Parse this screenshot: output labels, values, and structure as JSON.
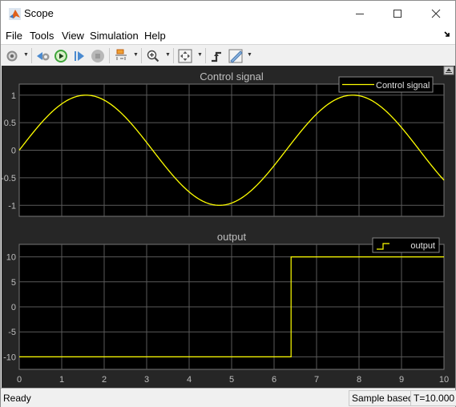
{
  "window": {
    "title": "Scope",
    "icons": {
      "app": "matlab-icon",
      "minimize": "minimize-icon",
      "maximize": "maximize-icon",
      "close": "close-icon"
    }
  },
  "menu": {
    "items": [
      "File",
      "Tools",
      "View",
      "Simulation",
      "Help"
    ]
  },
  "toolbar": {
    "buttons": [
      {
        "name": "configuration-properties",
        "icon": "gear-icon",
        "dropdown": true
      },
      {
        "name": "step-back",
        "icon": "step-back-icon",
        "dropdown": false
      },
      {
        "name": "run",
        "icon": "play-icon",
        "dropdown": false
      },
      {
        "name": "step-forward",
        "icon": "step-forward-icon",
        "dropdown": false
      },
      {
        "name": "stop",
        "icon": "stop-icon",
        "dropdown": false
      },
      {
        "name": "highlight-simulink-block",
        "icon": "highlight-block-icon",
        "dropdown": true
      },
      {
        "name": "zoom-in",
        "icon": "zoom-in-icon",
        "dropdown": true
      },
      {
        "name": "scale-axes",
        "icon": "autoscale-icon",
        "dropdown": true
      },
      {
        "name": "triggers",
        "icon": "trigger-icon",
        "dropdown": false
      },
      {
        "name": "cursor-measurements",
        "icon": "ruler-icon",
        "dropdown": true
      }
    ]
  },
  "status": {
    "state": "Ready",
    "mode": "Sample based",
    "time": "T=10.000"
  },
  "colors": {
    "trace": "#ffff00",
    "plot_bg": "#000000",
    "figure_bg": "#262626",
    "grid": "#5a5a5a",
    "tick_text": "#bfbfbf"
  },
  "chart_data": [
    {
      "type": "line",
      "title": "Control signal",
      "xlabel": "",
      "ylabel": "",
      "xlim": [
        0,
        10
      ],
      "ylim": [
        -1.2,
        1.2
      ],
      "xticks": [
        0,
        1,
        2,
        3,
        4,
        5,
        6,
        7,
        8,
        9,
        10
      ],
      "yticks": [
        -1,
        -0.5,
        0,
        0.5,
        1
      ],
      "ytick_labels": [
        "-1",
        "-0.5",
        "0",
        "0.5",
        "1"
      ],
      "show_xtick_labels": false,
      "grid": true,
      "legend": {
        "entries": [
          "Control signal"
        ],
        "placement": "top-right"
      },
      "series": [
        {
          "name": "Control signal",
          "function": "sin(t)",
          "x": [
            0,
            0.5,
            1,
            1.5708,
            2,
            2.5,
            3,
            3.5,
            4,
            4.7124,
            5,
            5.5,
            6,
            6.5,
            7,
            7.854,
            8,
            8.5,
            9,
            9.5,
            10
          ],
          "values": [
            0,
            0.479,
            0.841,
            1.0,
            0.909,
            0.598,
            0.141,
            -0.351,
            -0.757,
            -1.0,
            -0.959,
            -0.706,
            -0.279,
            0.215,
            0.657,
            1.0,
            0.989,
            0.798,
            0.412,
            -0.075,
            -0.544
          ]
        }
      ]
    },
    {
      "type": "line",
      "title": "output",
      "xlabel": "",
      "ylabel": "",
      "xlim": [
        0,
        10
      ],
      "ylim": [
        -12.5,
        12.5
      ],
      "xticks": [
        0,
        1,
        2,
        3,
        4,
        5,
        6,
        7,
        8,
        9,
        10
      ],
      "xtick_labels": [
        "0",
        "1",
        "2",
        "3",
        "4",
        "5",
        "6",
        "7",
        "8",
        "9",
        "10"
      ],
      "yticks": [
        -10,
        -5,
        0,
        5,
        10
      ],
      "ytick_labels": [
        "-10",
        "-5",
        "0",
        "5",
        "10"
      ],
      "grid": true,
      "legend": {
        "entries": [
          "output"
        ],
        "placement": "top-right",
        "marker": "stairs"
      },
      "series": [
        {
          "name": "output",
          "step": true,
          "x": [
            0,
            6.4,
            6.4,
            10
          ],
          "values": [
            -10,
            -10,
            10,
            10
          ]
        }
      ]
    }
  ]
}
